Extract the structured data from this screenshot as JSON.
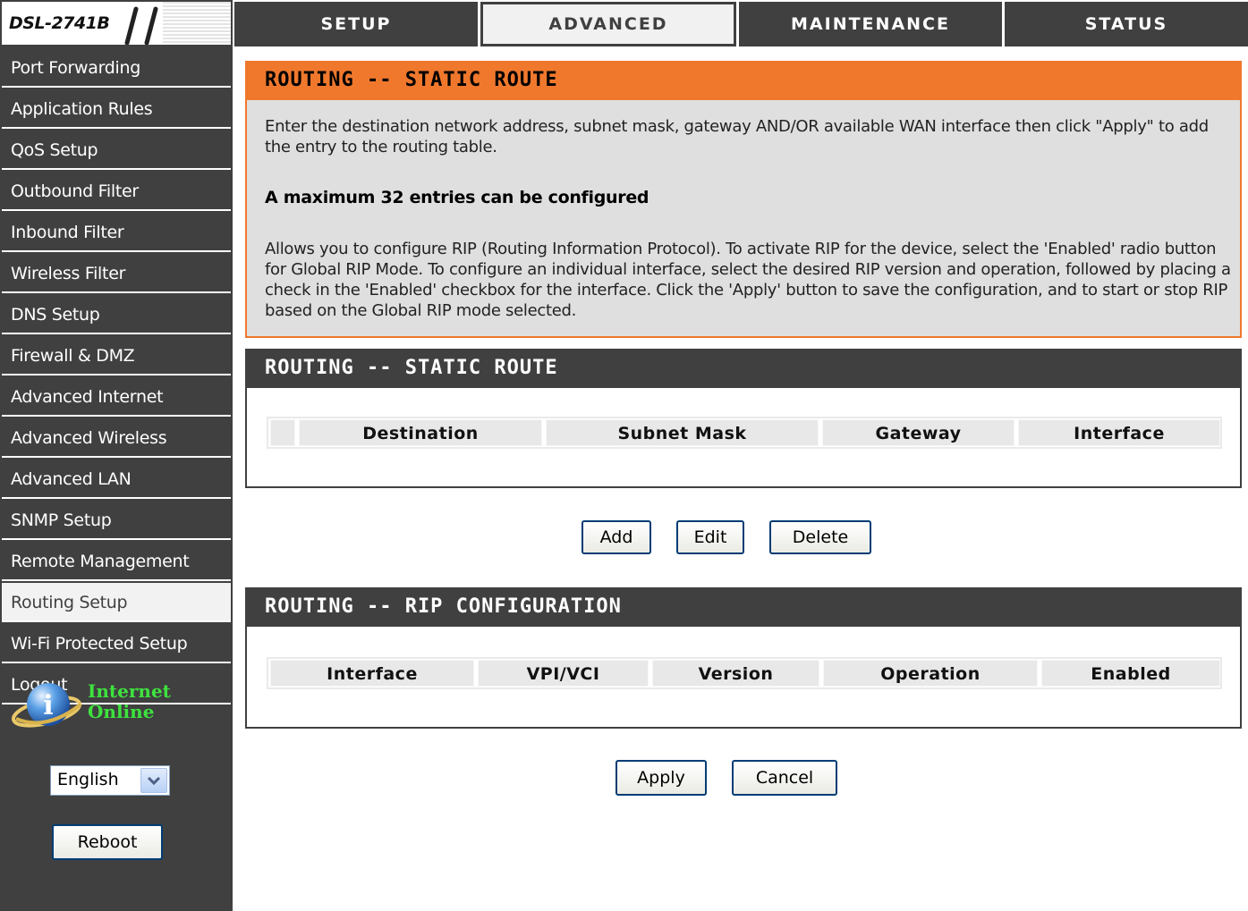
{
  "header": {
    "model": "DSL-2741B",
    "tabs": [
      {
        "label": "SETUP"
      },
      {
        "label": "ADVANCED"
      },
      {
        "label": "MAINTENANCE"
      },
      {
        "label": "STATUS"
      }
    ]
  },
  "sidebar": {
    "items": [
      {
        "label": "Port Forwarding"
      },
      {
        "label": "Application Rules"
      },
      {
        "label": "QoS Setup"
      },
      {
        "label": "Outbound Filter"
      },
      {
        "label": "Inbound Filter"
      },
      {
        "label": "Wireless Filter"
      },
      {
        "label": "DNS Setup"
      },
      {
        "label": "Firewall & DMZ"
      },
      {
        "label": "Advanced Internet"
      },
      {
        "label": "Advanced Wireless"
      },
      {
        "label": "Advanced LAN"
      },
      {
        "label": "SNMP Setup"
      },
      {
        "label": "Remote Management"
      },
      {
        "label": "Routing Setup"
      },
      {
        "label": "Wi-Fi Protected Setup"
      },
      {
        "label": "Logout"
      }
    ],
    "status_line1": "Internet",
    "status_line2": "Online",
    "status_color": "#3ee23e",
    "status_icon": "info-globe-icon",
    "language": "English",
    "reboot_label": "Reboot"
  },
  "info": {
    "title": "ROUTING -- STATIC ROUTE",
    "text1": "Enter the destination network address, subnet mask, gateway AND/OR available WAN interface then click \"Apply\" to add the entry to the routing table.",
    "text2": "A maximum 32 entries can be configured",
    "text3": "Allows you to configure RIP (Routing Information Protocol). To activate RIP for the device, select the 'Enabled' radio button for Global RIP Mode. To configure an individual interface, select the desired RIP version and operation, followed by placing a check in the 'Enabled' checkbox for the interface. Click the 'Apply' button to save the configuration, and to start or stop RIP based on the Global RIP mode selected."
  },
  "static_route": {
    "title": "ROUTING -- STATIC ROUTE",
    "columns": [
      "",
      "Destination",
      "Subnet Mask",
      "Gateway",
      "Interface"
    ],
    "add_label": "Add",
    "edit_label": "Edit",
    "delete_label": "Delete"
  },
  "rip": {
    "title": "ROUTING -- RIP CONFIGURATION",
    "columns": [
      "Interface",
      "VPI/VCI",
      "Version",
      "Operation",
      "Enabled"
    ],
    "apply_label": "Apply",
    "cancel_label": "Cancel"
  },
  "colors": {
    "accent": "#f0782d",
    "dark": "#404040",
    "info_background": "#dfdfdf"
  }
}
